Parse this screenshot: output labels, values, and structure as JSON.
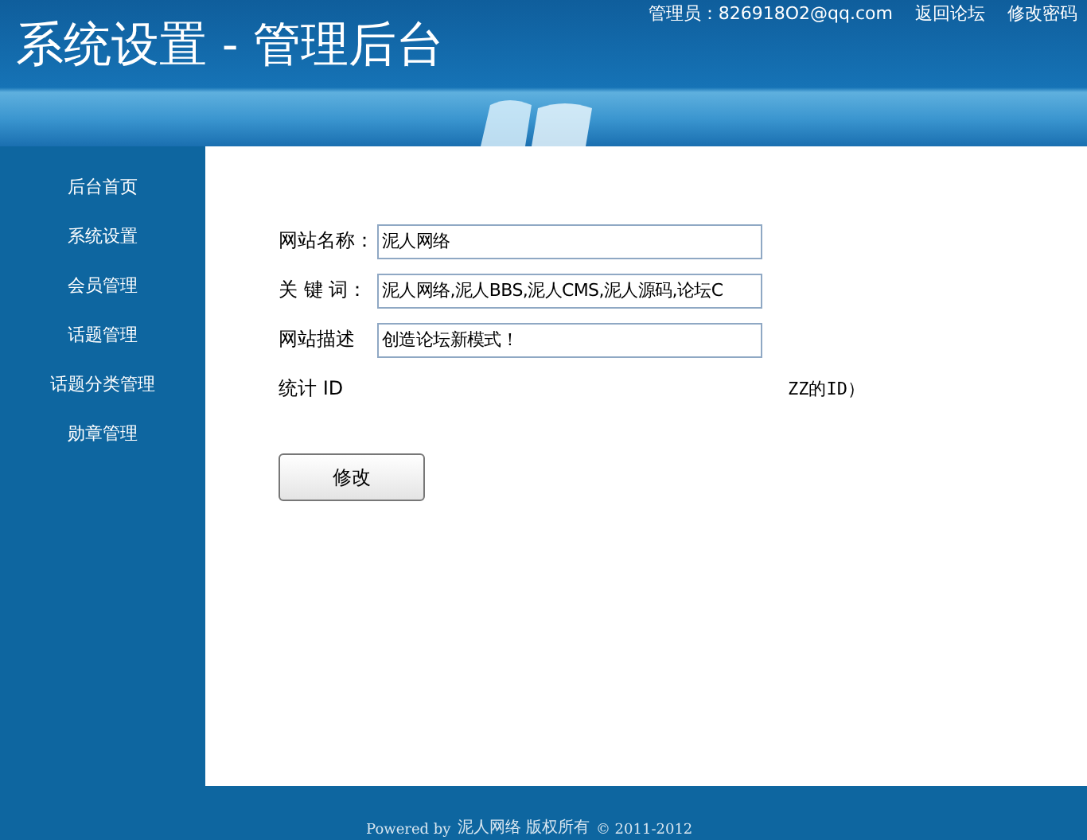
{
  "header": {
    "title": "系统设置 - 管理后台",
    "admin": "管理员：826918O2@qq.com",
    "links": [
      "返回论坛",
      "修改密码"
    ]
  },
  "sidebar": {
    "items": [
      "后台首页",
      "系统设置",
      "会员管理",
      "话题管理",
      "话题分类管理",
      "勋章管理"
    ]
  },
  "form": {
    "fields": [
      {
        "label": "网站名称：",
        "value": "泥人网络"
      },
      {
        "label": "关 键 词：",
        "value": "泥人网络,泥人BBS,泥人CMS,泥人源码,论坛C"
      },
      {
        "label": "网站描述",
        "value": "创造论坛新模式！"
      },
      {
        "label": "统计 ID",
        "hint": "ZZ的ID）"
      }
    ],
    "button": "修改"
  },
  "footer": {
    "powered": "Powered by",
    "brand": "泥人网络 版权所有",
    "copyright": "© 2011-2012"
  }
}
